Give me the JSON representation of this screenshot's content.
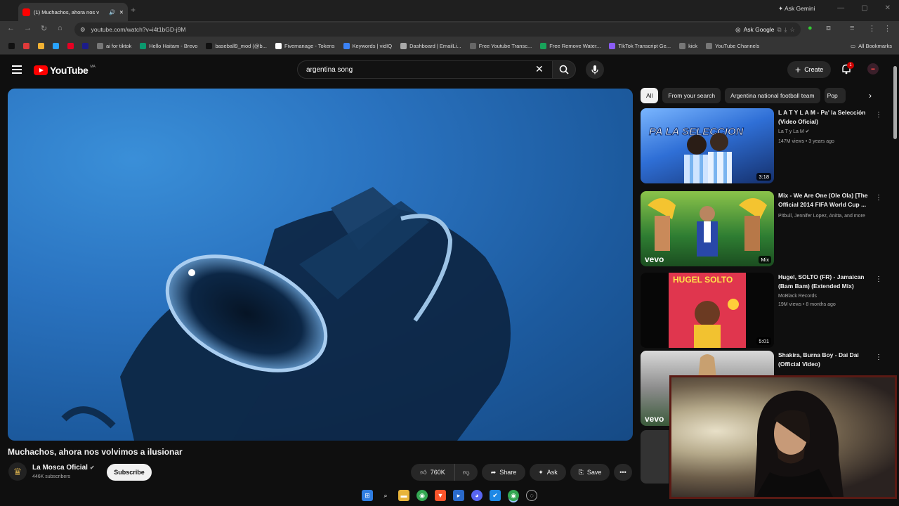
{
  "browser": {
    "tab": {
      "title": "(1) Muchachos, ahora nos v",
      "audio_icon": "speaker-icon"
    },
    "new_tab": "+",
    "ask_gemini": "Ask Gemini",
    "url": "youtube.com/watch?v=i4t1bGD-j9M",
    "ask_google": "Ask Google",
    "bookmarks": [
      {
        "label": "",
        "color": "#111111"
      },
      {
        "label": "",
        "color": "#e03a3a"
      },
      {
        "label": "",
        "color": "#f2b233"
      },
      {
        "label": "",
        "color": "#29a3ff"
      },
      {
        "label": "",
        "color": "#e60023"
      },
      {
        "label": "",
        "color": "#1c1c8a"
      },
      {
        "label": "ai for tiktok",
        "color": "#777777"
      },
      {
        "label": "Hello Haitam - Brevo",
        "color": "#0b996e"
      },
      {
        "label": "baseball9_mod (@b...",
        "color": "#111111"
      },
      {
        "label": "Fivemanage - Tokens",
        "color": "#ffffff"
      },
      {
        "label": "Keywords | vidIQ",
        "color": "#3b82f6"
      },
      {
        "label": "Dashboard | EmailLi...",
        "color": "#aaaaaa"
      },
      {
        "label": "Free Youtube Transc...",
        "color": "#666666"
      },
      {
        "label": "Free Remove Water...",
        "color": "#18a35a"
      },
      {
        "label": "TikTok Transcript Ge...",
        "color": "#8b5cf6"
      },
      {
        "label": "kick",
        "color": "#777777"
      },
      {
        "label": "YouTube Channels",
        "color": "#777777"
      }
    ],
    "all_bookmarks": "All Bookmarks"
  },
  "youtube": {
    "logo_text": "YouTube",
    "country_code": "MA",
    "search_query": "argentina song",
    "create_label": "Create",
    "notification_count": "1",
    "video": {
      "title": "Muchachos, ahora nos volvimos a ilusionar",
      "channel": "La Mosca Oficial",
      "subscribers": "446K subscribers",
      "subscribe_label": "Subscribe",
      "likes": "760K",
      "share_label": "Share",
      "ask_label": "Ask",
      "save_label": "Save"
    },
    "chips": [
      "All",
      "From your search",
      "Argentina national football team",
      "Pop"
    ],
    "recommendations": [
      {
        "title": "L A T Y L A M - Pa' la Selección (Video Oficial)",
        "channel": "La T y La M",
        "verified": true,
        "meta": "147M views • 3 years ago",
        "duration": "3:18",
        "thumb_text": "PA LA SELECCION"
      },
      {
        "title": "Mix - We Are One (Ole Ola) [The Official 2014 FIFA World Cup ...",
        "channel": "Pitbull, Jennifer Lopez, Anitta, and more",
        "verified": false,
        "meta": "",
        "duration": "Mix",
        "thumb_text": "vevo"
      },
      {
        "title": "Hugel, SOLTO (FR) - Jamaican (Bam Bam) (Extended Mix)",
        "channel": "MoBlack Records",
        "verified": false,
        "meta": "19M views • 8 months ago",
        "duration": "5:01",
        "thumb_text": "HUGEL SOLTO"
      },
      {
        "title": "Shakira, Burna Boy - Dai Dai (Official Video)",
        "channel": "",
        "verified": false,
        "meta": "",
        "duration": "",
        "thumb_text": "vevo"
      }
    ]
  }
}
